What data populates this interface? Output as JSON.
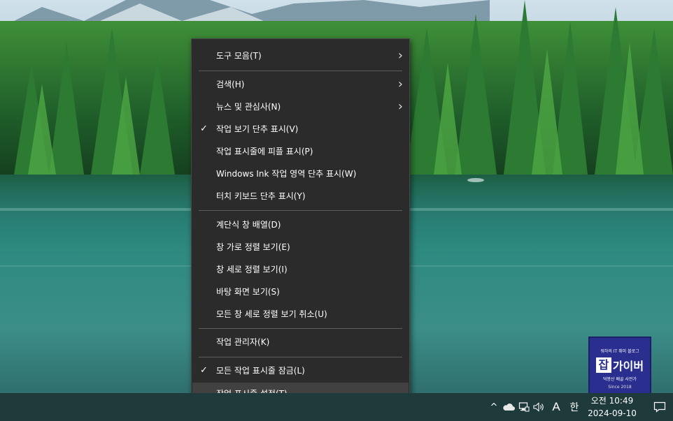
{
  "menu": {
    "items": [
      {
        "label": "도구 모음(T)",
        "submenu": true
      },
      {
        "label": "검색(H)",
        "submenu": true
      },
      {
        "label": "뉴스 및 관심사(N)",
        "submenu": true
      },
      {
        "label": "작업 보기 단추 표시(V)",
        "checked": true
      },
      {
        "label": "작업 표시줄에 피플 표시(P)"
      },
      {
        "label": "Windows Ink 작업 영역 단추 표시(W)"
      },
      {
        "label": "터치 키보드 단추 표시(Y)"
      },
      {
        "label": "계단식 창 배열(D)"
      },
      {
        "label": "창 가로 정렬 보기(E)"
      },
      {
        "label": "창 세로 정렬 보기(I)"
      },
      {
        "label": "바탕 화면 보기(S)"
      },
      {
        "label": "모든 창 세로 정렬 보기 취소(U)"
      },
      {
        "label": "작업 관리자(K)"
      },
      {
        "label": "모든 작업 표시줄 잠금(L)",
        "checked": true
      },
      {
        "label": "작업 표시줄 설정(T)",
        "icon": "gear-icon",
        "highlighted": true
      }
    ],
    "check_glyph": "✓",
    "submenu_glyph": "›"
  },
  "taskbar": {
    "chevron": "^",
    "ime_mode": "A",
    "ime_lang": "한",
    "clock_time": "오전 10:49",
    "clock_date": "2024-09-10",
    "icons": [
      "show-hidden-icons-chevron",
      "onedrive-cloud-icon",
      "network-icon",
      "volume-icon",
      "notification-icon"
    ]
  },
  "watermark": {
    "top": "워하의 IT 취미 블로그",
    "logo_box": "잡",
    "logo_text": "가이버",
    "sub": "덕봉산 배골 사전가",
    "since": "Since 2018"
  },
  "colors": {
    "menu_bg": "#2b2b2b",
    "menu_hover": "#414141",
    "taskbar_bg": "#1f3a3b",
    "badge_bg": "#2a2e8f"
  }
}
